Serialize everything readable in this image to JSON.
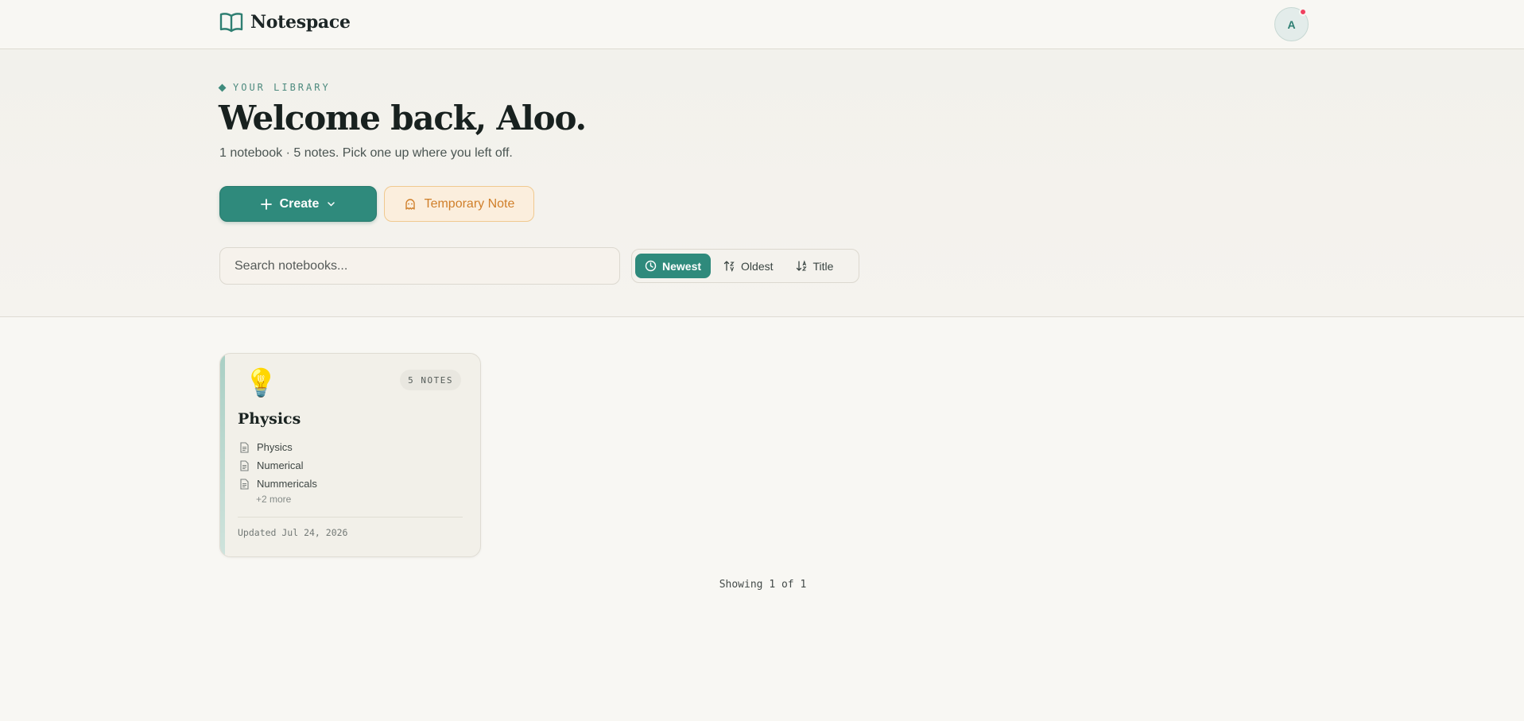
{
  "app": {
    "name": "Notespace"
  },
  "user": {
    "initial": "A"
  },
  "hero": {
    "eyebrow": "YOUR LIBRARY",
    "headline": "Welcome back, Aloo.",
    "subline": "1 notebook · 5 notes. Pick one up where you left off."
  },
  "actions": {
    "create_label": "Create",
    "temporary_label": "Temporary Note"
  },
  "search": {
    "placeholder": "Search notebooks..."
  },
  "sort": {
    "options": [
      {
        "label": "Newest",
        "active": true,
        "icon": "clock-icon"
      },
      {
        "label": "Oldest",
        "active": false,
        "icon": "sort-ascending-icon"
      },
      {
        "label": "Title",
        "active": false,
        "icon": "sort-alpha-icon"
      }
    ]
  },
  "notebooks": [
    {
      "emoji": "💡",
      "title": "Physics",
      "badge": "5 NOTES",
      "notes": [
        "Physics",
        "Numerical",
        "Nummericals"
      ],
      "more": "+2 more",
      "updated": "Updated Jul 24, 2026"
    }
  ],
  "pagination": {
    "text": "Showing 1 of 1"
  },
  "colors": {
    "accent": "#2f8a7c",
    "temp_note": "#d07f2a",
    "notification": "#f0415f"
  }
}
